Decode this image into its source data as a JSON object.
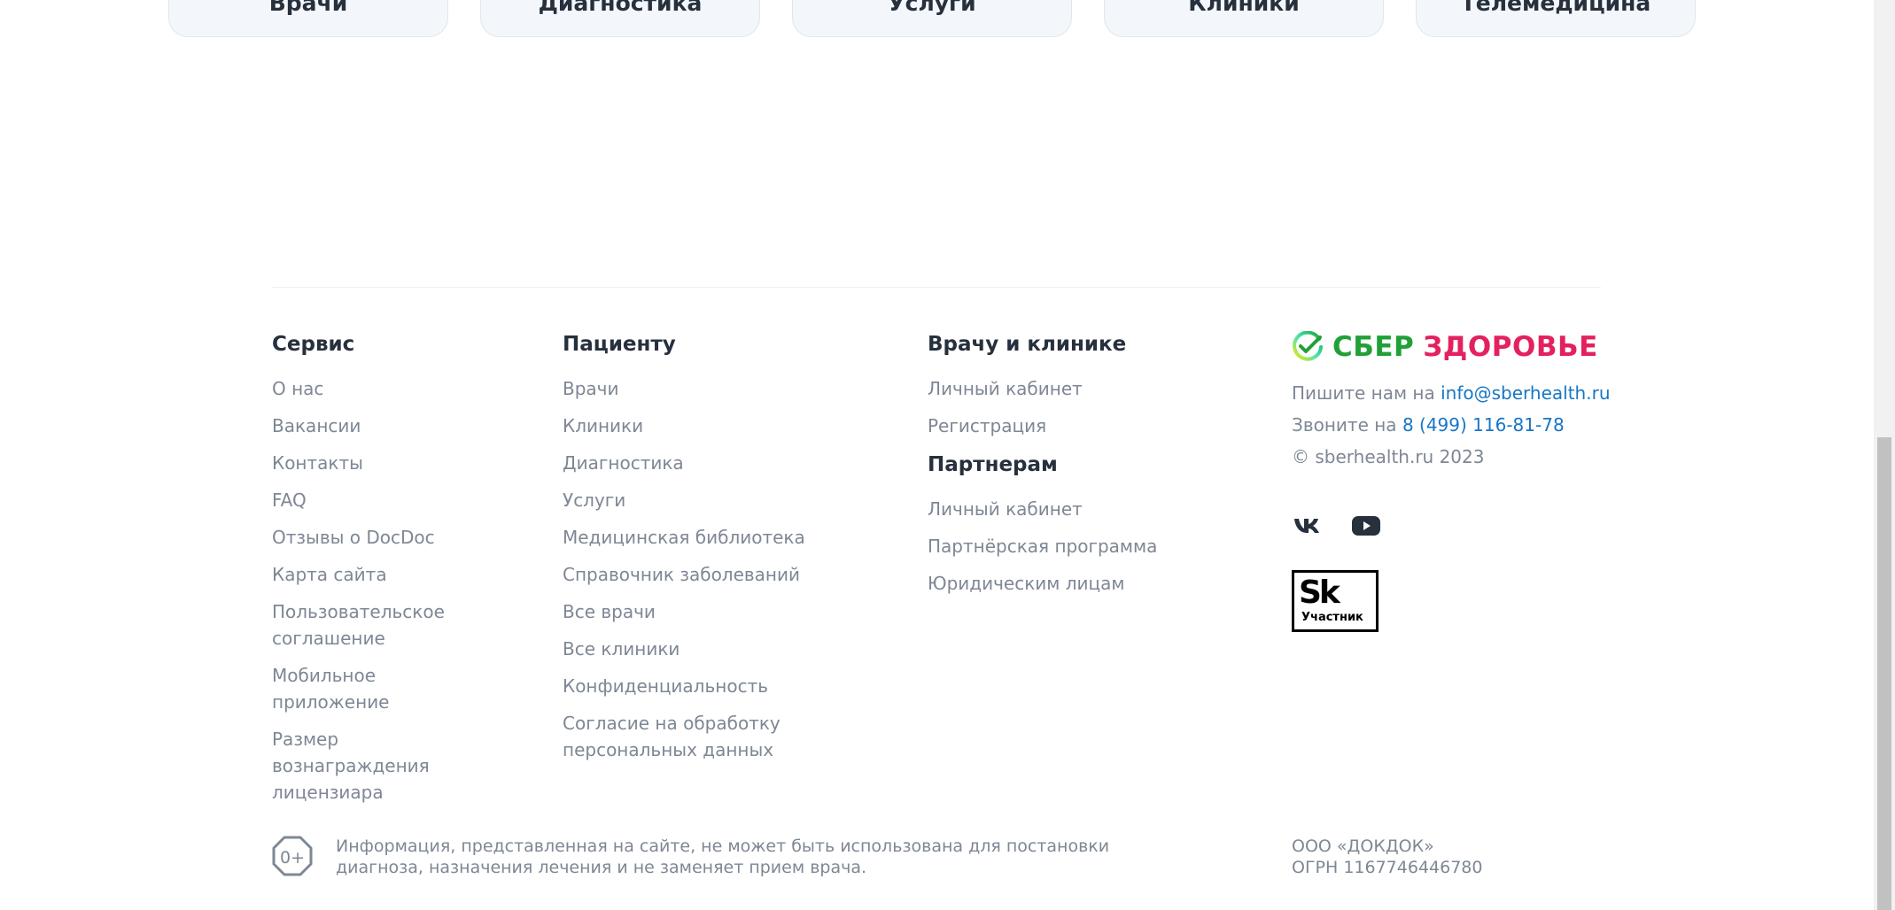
{
  "categories": [
    {
      "label": "Врачи"
    },
    {
      "label": "Диагностика"
    },
    {
      "label": "Услуги"
    },
    {
      "label": "Клиники"
    },
    {
      "label": "Телемедицина"
    }
  ],
  "footer": {
    "service": {
      "title": "Сервис",
      "items": [
        "О нас",
        "Вакансии",
        "Контакты",
        "FAQ",
        "Отзывы о DocDoc",
        "Карта сайта",
        "Пользовательское соглашение",
        "Мобильное приложение",
        "Размер вознаграждения лицензиара"
      ]
    },
    "patient": {
      "title": "Пациенту",
      "items": [
        "Врачи",
        "Клиники",
        "Диагностика",
        "Услуги",
        "Медицинская библиотека",
        "Справочник заболеваний",
        "Все врачи",
        "Все клиники",
        "Конфиденциальность",
        "Согласие на обработку персональных данных"
      ]
    },
    "doctor": {
      "title": "Врачу и клинике",
      "items": [
        "Личный кабинет",
        "Регистрация"
      ]
    },
    "partners": {
      "title": "Партнерам",
      "items": [
        "Личный кабинет",
        "Партнёрская программа",
        "Юридическим лицам"
      ]
    },
    "brand": {
      "logo_sber": "СБЕР",
      "logo_zdorovie": "ЗДОРОВЬЕ",
      "write_label": "Пишите нам на",
      "email": "info@sberhealth.ru",
      "call_label": "Звоните на",
      "phone": "8 (499) 116-81-78",
      "copyright": "© sberhealth.ru 2023",
      "socials": [
        {
          "icon": "vk-icon"
        },
        {
          "icon": "youtube-icon"
        }
      ],
      "sk_badge_big": "Sk",
      "sk_badge_small": "Участник",
      "colors": {
        "sber_green": "#21a038",
        "zdorovie_pink": "#e4215f",
        "link_blue": "#1776c6"
      }
    },
    "age_rating": "0+",
    "disclaimer": "Информация, представленная на сайте, не может быть использована для постановки диагноза, назначения лечения и не заменяет прием врача.",
    "company_name": "ООО «ДОКДОК»",
    "company_ogrn": "ОГРН 1167746446780"
  }
}
